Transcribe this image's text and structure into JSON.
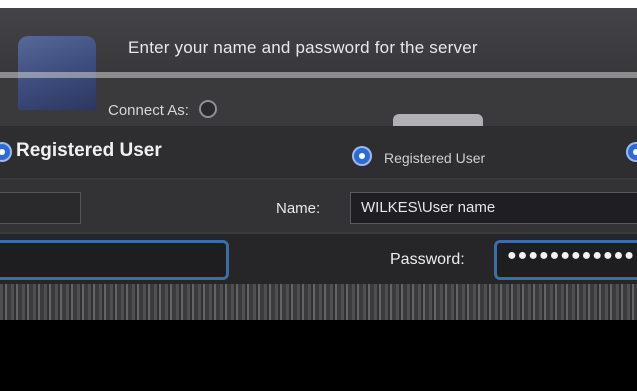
{
  "dialog": {
    "prompt": "Enter your name and password for the server",
    "connect_as_label": "Connect As:",
    "registered_user_label": "Registered User",
    "registered_user_label_right": "Registered User",
    "name_label": "Name:",
    "name_value": "WILKES\\User name",
    "password_label": "Password:",
    "password_masked": "●●●●●●●●●●●●"
  },
  "icons": {
    "server": "server-icon"
  },
  "colors": {
    "accent": "#2d6bd4",
    "focus_ring": "#3d6da6",
    "background": "#3a3a3c"
  }
}
